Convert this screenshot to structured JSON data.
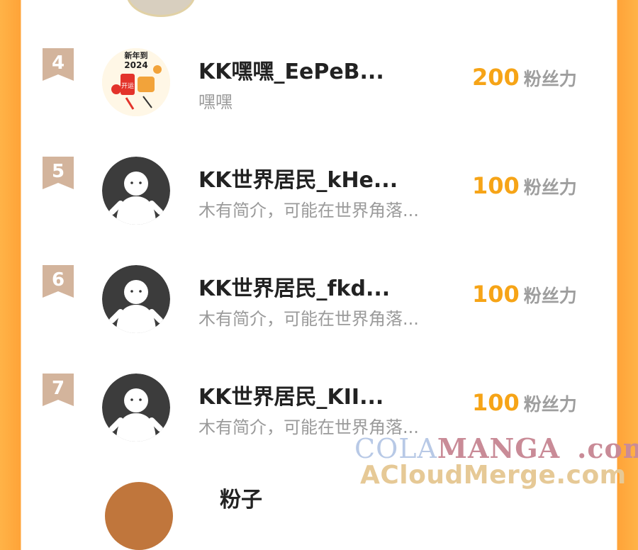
{
  "entries": [
    {
      "rank": "4",
      "name": "KK嘿嘿_EePeB...",
      "bio": "嘿嘿",
      "score": "200",
      "unit": "粉丝力",
      "avatar": "new-year-2024-avatar"
    },
    {
      "rank": "5",
      "name": "KK世界居民_kHe...",
      "bio": "木有简介，可能在世界角落...",
      "score": "100",
      "unit": "粉丝力",
      "avatar": "default-avatar"
    },
    {
      "rank": "6",
      "name": "KK世界居民_fkd...",
      "bio": "木有简介，可能在世界角落...",
      "score": "100",
      "unit": "粉丝力",
      "avatar": "default-avatar"
    },
    {
      "rank": "7",
      "name": "KK世界居民_KII...",
      "bio": "木有简介，可能在世界角落...",
      "score": "100",
      "unit": "粉丝力",
      "avatar": "default-avatar"
    }
  ],
  "partial_next": {
    "name": "粉子"
  },
  "avatar_badge": {
    "line1": "新年到",
    "line2": "2024",
    "tag": "开运"
  },
  "watermark": {
    "part1": "COLA",
    "part2": "MANGA",
    "part3": ".com",
    "line2": "ACloudMerge.com"
  },
  "colors": {
    "accent": "#ffa338",
    "score": "#f6a417",
    "rank_badge": "#d3b49c"
  }
}
